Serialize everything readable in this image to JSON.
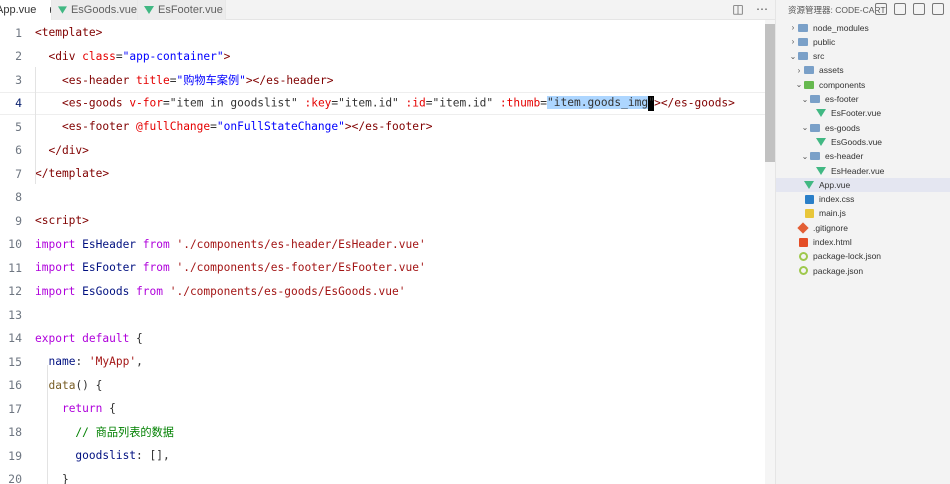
{
  "tabs": [
    {
      "label": "App.vue",
      "active": true,
      "modified": true
    },
    {
      "label": "EsGoods.vue",
      "active": false
    },
    {
      "label": "EsFooter.vue",
      "active": false
    }
  ],
  "editor": {
    "line_numbers": [
      "1",
      "2",
      "3",
      "4",
      "5",
      "6",
      "7",
      "8",
      "9",
      "10",
      "11",
      "12",
      "13",
      "14",
      "15",
      "16",
      "17",
      "18",
      "19",
      "20"
    ],
    "current_line": 4,
    "lines": [
      [
        {
          "c": "t-tag",
          "t": "<template>"
        }
      ],
      [
        {
          "c": "",
          "t": "  "
        },
        {
          "c": "t-tag",
          "t": "<div "
        },
        {
          "c": "t-attr",
          "t": "class"
        },
        {
          "c": "",
          "t": "="
        },
        {
          "c": "t-str",
          "t": "\"app-container\""
        },
        {
          "c": "t-tag",
          "t": ">"
        }
      ],
      [
        {
          "c": "",
          "t": "    "
        },
        {
          "c": "t-tag",
          "t": "<es-header "
        },
        {
          "c": "t-attr",
          "t": "title"
        },
        {
          "c": "",
          "t": "="
        },
        {
          "c": "t-str",
          "t": "\"购物车案例\""
        },
        {
          "c": "t-tag",
          "t": "></es-header>"
        }
      ],
      [
        {
          "c": "",
          "t": "    "
        },
        {
          "c": "t-tag",
          "t": "<es-goods "
        },
        {
          "c": "t-attr",
          "t": "v-for"
        },
        {
          "c": "",
          "t": "="
        },
        {
          "c": "",
          "t": "\"item in goodslist\" "
        },
        {
          "c": "t-attr",
          "t": ":key"
        },
        {
          "c": "",
          "t": "="
        },
        {
          "c": "",
          "t": "\"item.id\" "
        },
        {
          "c": "t-attr",
          "t": ":id"
        },
        {
          "c": "",
          "t": "="
        },
        {
          "c": "",
          "t": "\"item.id\" "
        },
        {
          "c": "t-attr",
          "t": ":thumb"
        },
        {
          "c": "",
          "t": "="
        },
        {
          "c": "sel",
          "t": "\"item.goods_img"
        },
        {
          "c": "caret",
          "t": "\""
        },
        {
          "c": "t-tag",
          "t": "></es-goods>"
        }
      ],
      [
        {
          "c": "",
          "t": "    "
        },
        {
          "c": "t-tag",
          "t": "<es-footer "
        },
        {
          "c": "t-attr",
          "t": "@fullChange"
        },
        {
          "c": "",
          "t": "="
        },
        {
          "c": "t-str",
          "t": "\"onFullStateChange\""
        },
        {
          "c": "t-tag",
          "t": "></es-footer>"
        }
      ],
      [
        {
          "c": "",
          "t": "  "
        },
        {
          "c": "t-tag",
          "t": "</div>"
        }
      ],
      [
        {
          "c": "t-tag",
          "t": "</template>"
        }
      ],
      [],
      [
        {
          "c": "t-tag",
          "t": "<script>"
        }
      ],
      [
        {
          "c": "t-kw",
          "t": "import "
        },
        {
          "c": "t-prop",
          "t": "EsHeader "
        },
        {
          "c": "t-kw",
          "t": "from "
        },
        {
          "c": "t-sstr",
          "t": "'./components/es-header/EsHeader.vue'"
        }
      ],
      [
        {
          "c": "t-kw",
          "t": "import "
        },
        {
          "c": "t-prop",
          "t": "EsFooter "
        },
        {
          "c": "t-kw",
          "t": "from "
        },
        {
          "c": "t-sstr",
          "t": "'./components/es-footer/EsFooter.vue'"
        }
      ],
      [
        {
          "c": "t-kw",
          "t": "import "
        },
        {
          "c": "t-prop",
          "t": "EsGoods "
        },
        {
          "c": "t-kw",
          "t": "from "
        },
        {
          "c": "t-sstr",
          "t": "'./components/es-goods/EsGoods.vue'"
        }
      ],
      [],
      [
        {
          "c": "t-kw",
          "t": "export "
        },
        {
          "c": "t-kw",
          "t": "default "
        },
        {
          "c": "",
          "t": "{"
        }
      ],
      [
        {
          "c": "",
          "t": "  "
        },
        {
          "c": "t-prop",
          "t": "name"
        },
        {
          "c": "",
          "t": ": "
        },
        {
          "c": "t-sstr",
          "t": "'MyApp'"
        },
        {
          "c": "",
          "t": ","
        }
      ],
      [
        {
          "c": "",
          "t": "  "
        },
        {
          "c": "t-fn",
          "t": "data"
        },
        {
          "c": "",
          "t": "() {"
        }
      ],
      [
        {
          "c": "",
          "t": "    "
        },
        {
          "c": "t-kw",
          "t": "return "
        },
        {
          "c": "",
          "t": "{"
        }
      ],
      [
        {
          "c": "",
          "t": "      "
        },
        {
          "c": "t-com",
          "t": "// 商品列表的数据"
        }
      ],
      [
        {
          "c": "",
          "t": "      "
        },
        {
          "c": "t-prop",
          "t": "goodslist"
        },
        {
          "c": "",
          "t": ": [],"
        }
      ],
      [
        {
          "c": "",
          "t": "    }"
        }
      ]
    ]
  },
  "explorer": {
    "title": "资源管理器: CODE-CART",
    "items": [
      {
        "label": "node_modules",
        "icon": "folder",
        "chev": "›",
        "depth": 0
      },
      {
        "label": "public",
        "icon": "folder",
        "chev": "›",
        "depth": 0
      },
      {
        "label": "src",
        "icon": "folder",
        "chev": "⌄",
        "depth": 0
      },
      {
        "label": "assets",
        "icon": "folder",
        "chev": "›",
        "depth": 1
      },
      {
        "label": "components",
        "icon": "folder-green",
        "chev": "⌄",
        "depth": 1
      },
      {
        "label": "es-footer",
        "icon": "folder",
        "chev": "⌄",
        "depth": 2
      },
      {
        "label": "EsFooter.vue",
        "icon": "vue",
        "chev": "",
        "depth": 3
      },
      {
        "label": "es-goods",
        "icon": "folder",
        "chev": "⌄",
        "depth": 2
      },
      {
        "label": "EsGoods.vue",
        "icon": "vue",
        "chev": "",
        "depth": 3
      },
      {
        "label": "es-header",
        "icon": "folder",
        "chev": "⌄",
        "depth": 2
      },
      {
        "label": "EsHeader.vue",
        "icon": "vue",
        "chev": "",
        "depth": 3
      },
      {
        "label": "App.vue",
        "icon": "vue",
        "chev": "",
        "depth": 1,
        "selected": true
      },
      {
        "label": "index.css",
        "icon": "css",
        "chev": "",
        "depth": 1
      },
      {
        "label": "main.js",
        "icon": "js",
        "chev": "",
        "depth": 1
      },
      {
        "label": ".gitignore",
        "icon": "git",
        "chev": "",
        "depth": 0
      },
      {
        "label": "index.html",
        "icon": "html",
        "chev": "",
        "depth": 0
      },
      {
        "label": "package-lock.json",
        "icon": "json",
        "chev": "",
        "depth": 0
      },
      {
        "label": "package.json",
        "icon": "json",
        "chev": "",
        "depth": 0
      }
    ]
  },
  "colors": {
    "accent": "#007acc",
    "selection": "#add6ff",
    "vue": "#41b883"
  }
}
